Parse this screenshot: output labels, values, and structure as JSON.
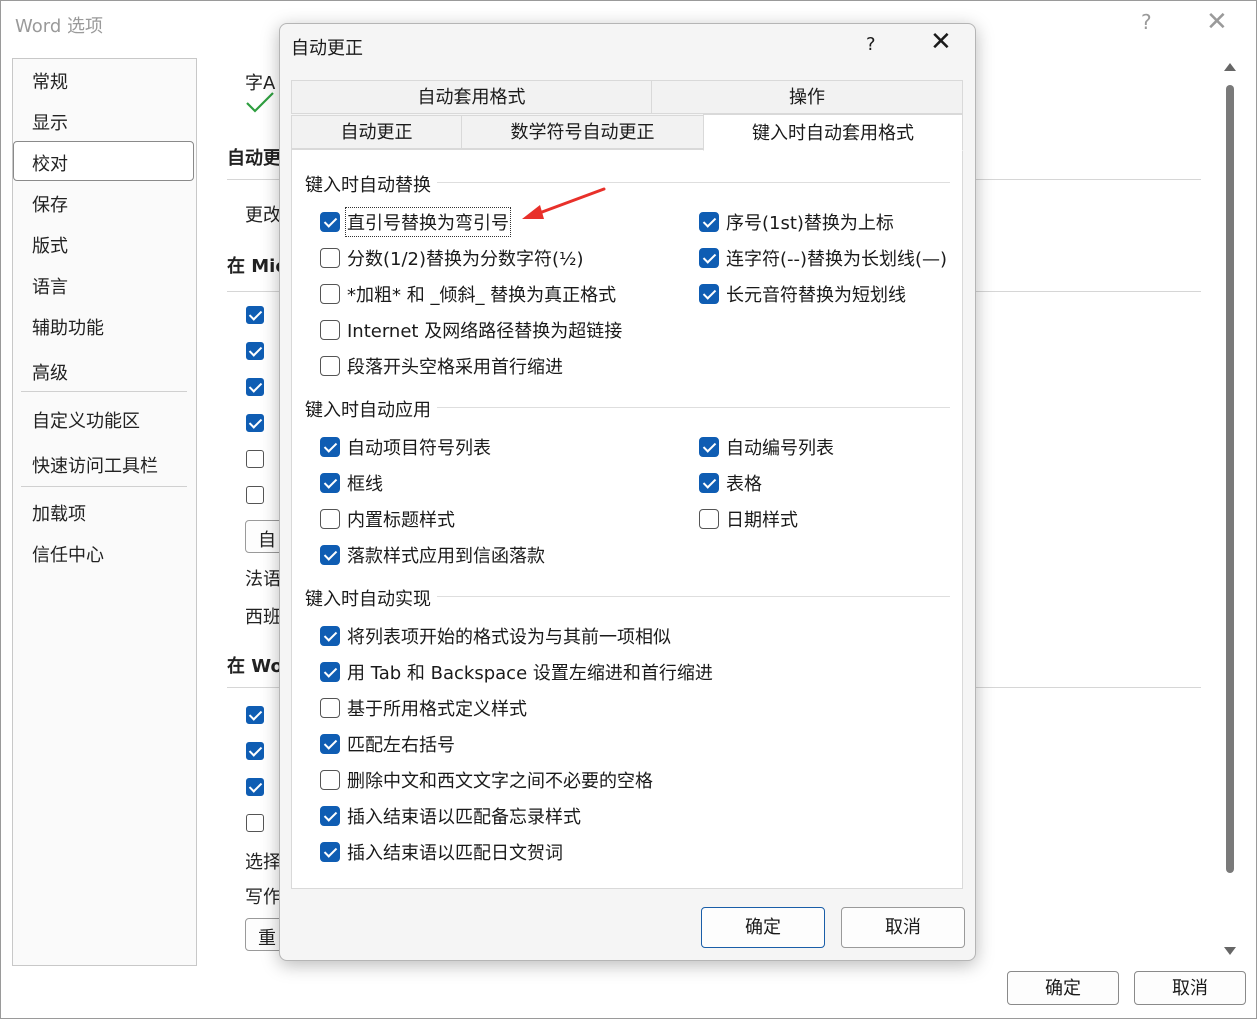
{
  "outer_window": {
    "title": "Word 选项",
    "help_icon": "?",
    "close_icon": "✕",
    "sidebar": [
      "常规",
      "显示",
      "校对",
      "保存",
      "版式",
      "语言",
      "辅助功能",
      "高级",
      "自定义功能区",
      "快速访问工具栏",
      "加载项",
      "信任中心"
    ],
    "selected_sidebar": "校对",
    "fragments": {
      "f1": "字A",
      "f2": "自动更",
      "f3": "更改",
      "f4": "在 Mic",
      "f5": "自",
      "f6": "法语",
      "f7": "西班",
      "f8": "在 Wo",
      "f9": "选择",
      "f10": "写作",
      "f11": "重"
    },
    "ok_button": "确定",
    "cancel_button": "取消"
  },
  "dialog": {
    "title": "自动更正",
    "help_icon": "?",
    "close_icon": "✕",
    "tabs_row1": [
      "自动套用格式",
      "操作"
    ],
    "tabs_row2": [
      "自动更正",
      "数学符号自动更正",
      "键入时自动套用格式"
    ],
    "active_tab": "键入时自动套用格式",
    "sections": {
      "replace": {
        "title": "键入时自动替换",
        "left": [
          {
            "label": "直引号替换为弯引号",
            "checked": true
          },
          {
            "label": "分数(1/2)替换为分数字符(½)",
            "checked": false
          },
          {
            "label": "*加粗* 和 _倾斜_ 替换为真正格式",
            "checked": false
          },
          {
            "label": "Internet 及网络路径替换为超链接",
            "checked": false
          },
          {
            "label": "段落开头空格采用首行缩进",
            "checked": false
          }
        ],
        "right": [
          {
            "label": "序号(1st)替换为上标",
            "checked": true
          },
          {
            "label": "连字符(--)替换为长划线(—)",
            "checked": true
          },
          {
            "label": "长元音符替换为短划线",
            "checked": true
          }
        ]
      },
      "apply": {
        "title": "键入时自动应用",
        "left": [
          {
            "label": "自动项目符号列表",
            "checked": true
          },
          {
            "label": "框线",
            "checked": true
          },
          {
            "label": "内置标题样式",
            "checked": false
          },
          {
            "label": "落款样式应用到信函落款",
            "checked": true
          }
        ],
        "right": [
          {
            "label": "自动编号列表",
            "checked": true
          },
          {
            "label": "表格",
            "checked": true
          },
          {
            "label": "日期样式",
            "checked": false
          }
        ]
      },
      "implement": {
        "title": "键入时自动实现",
        "items": [
          {
            "label": "将列表项开始的格式设为与其前一项相似",
            "checked": true
          },
          {
            "label": "用 Tab 和 Backspace 设置左缩进和首行缩进",
            "checked": true
          },
          {
            "label": "基于所用格式定义样式",
            "checked": false
          },
          {
            "label": "匹配左右括号",
            "checked": true
          },
          {
            "label": "删除中文和西文文字之间不必要的空格",
            "checked": false
          },
          {
            "label": "插入结束语以匹配备忘录样式",
            "checked": true
          },
          {
            "label": "插入结束语以匹配日文贺词",
            "checked": true
          }
        ]
      }
    },
    "ok_button": "确定",
    "cancel_button": "取消"
  },
  "colors": {
    "checkbox_blue": "#0f5db3",
    "annotation_arrow": "#e8302a"
  }
}
